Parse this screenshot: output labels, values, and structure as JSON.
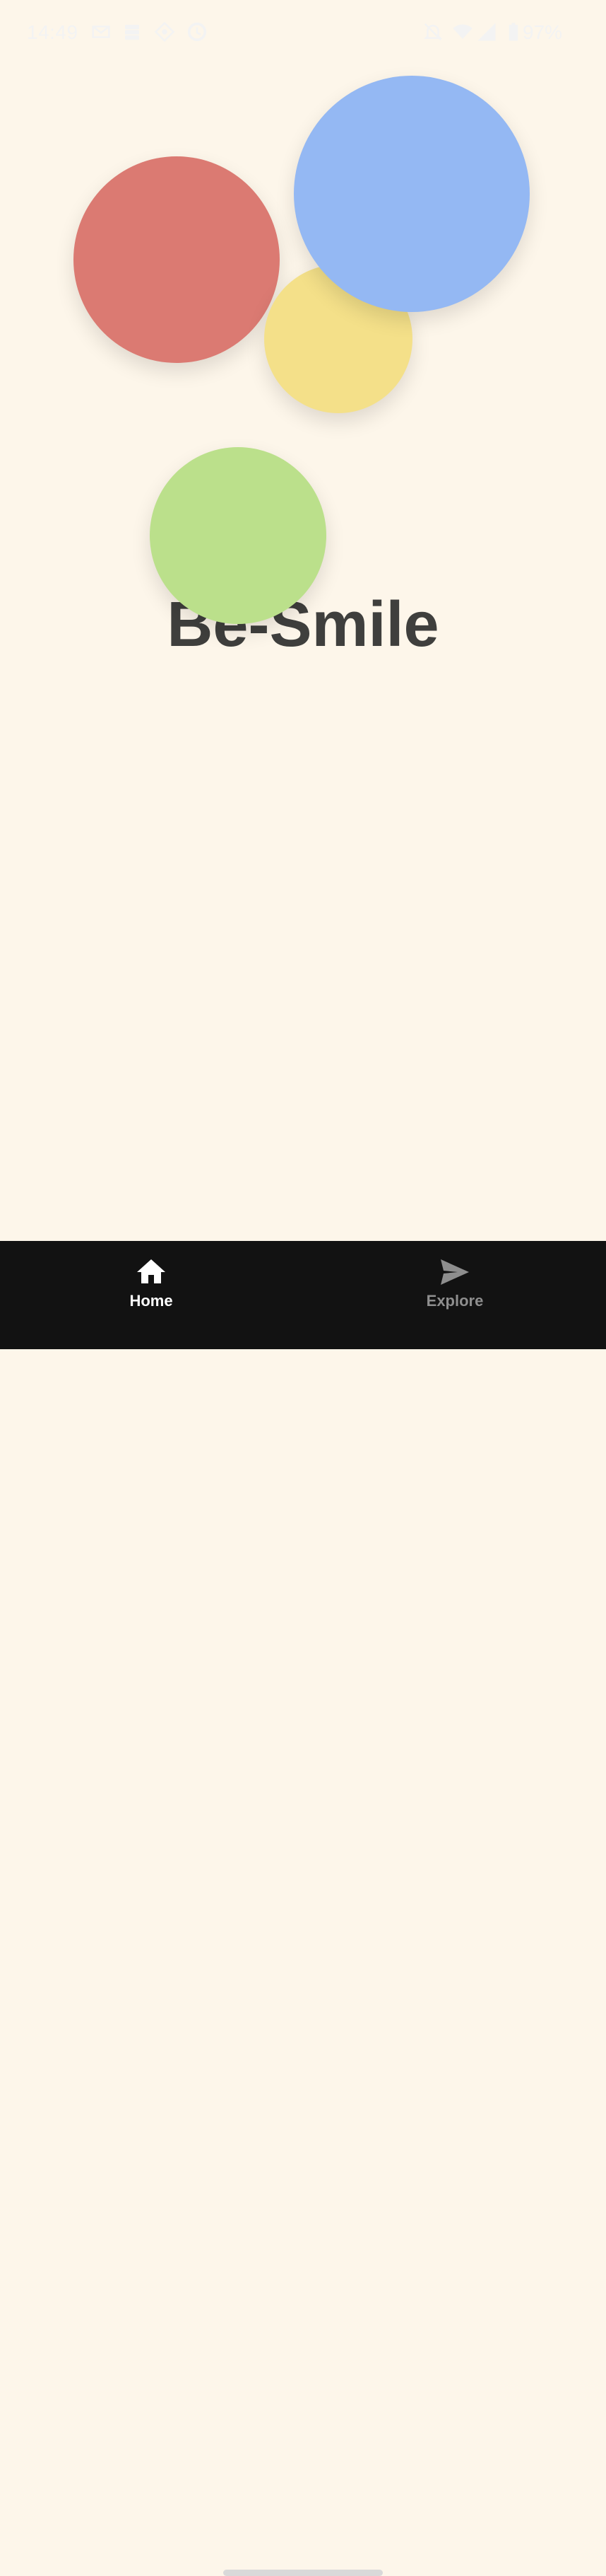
{
  "status_bar": {
    "time": "14:49",
    "battery": "97%",
    "icons": [
      "mail-icon",
      "storage-icon",
      "location-diamond-icon",
      "sync-icon",
      "notifications-off-icon",
      "wifi-icon",
      "signal-icon",
      "battery-icon"
    ]
  },
  "app": {
    "title": "Be-Smile"
  },
  "colors": {
    "background": "#FDF6EA",
    "red": "#DB7A72",
    "yellow": "#F4E089",
    "blue": "#94B8F3",
    "green": "#BBE08B",
    "nav_bg": "#121212"
  },
  "bottom_nav": {
    "items": [
      {
        "label": "Home",
        "icon": "home-icon",
        "active": true
      },
      {
        "label": "Explore",
        "icon": "send-icon",
        "active": false
      }
    ]
  }
}
